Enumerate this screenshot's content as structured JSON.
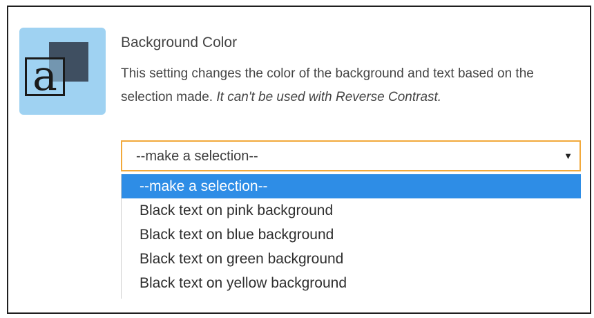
{
  "setting": {
    "icon_name": "text-background-icon",
    "icon_letter": "a",
    "title": "Background Color",
    "description": "This setting changes the color of the background and text based on the selection made.",
    "description_note": "It can't be used with Reverse Contrast."
  },
  "select": {
    "value": "--make a selection--",
    "arrow_icon": "triangle-down-icon",
    "focus_color": "#f2a93b",
    "options": [
      {
        "label": "--make a selection--",
        "selected": true
      },
      {
        "label": "Black text on pink background",
        "selected": false
      },
      {
        "label": "Black text on blue background",
        "selected": false
      },
      {
        "label": "Black text on green background",
        "selected": false
      },
      {
        "label": "Black text on yellow background",
        "selected": false
      }
    ]
  },
  "colors": {
    "highlight": "#2e8de6",
    "icon_background": "#9fd2f2",
    "icon_square": "#3f4f61"
  }
}
